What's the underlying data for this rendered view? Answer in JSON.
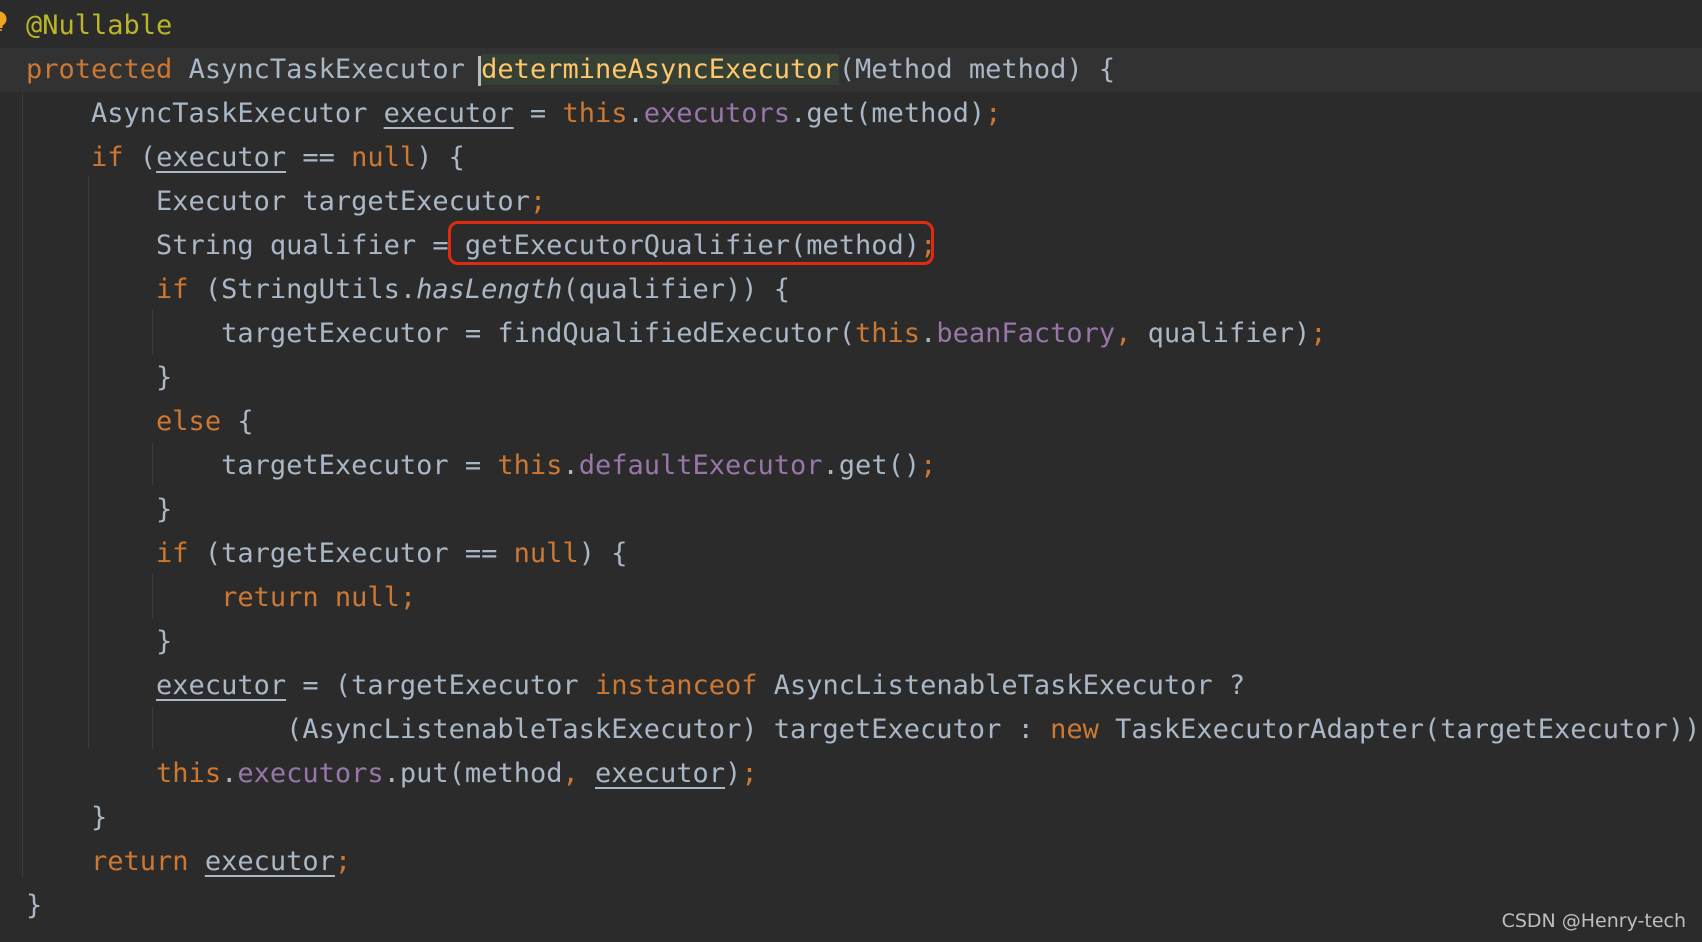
{
  "editor": {
    "lines": [
      {
        "segments": [
          {
            "t": "@Nullable",
            "c": "ann"
          }
        ]
      },
      {
        "current": true,
        "segments": [
          {
            "t": "protected ",
            "c": "kw"
          },
          {
            "t": "AsyncTaskExecutor "
          },
          {
            "caret": true
          },
          {
            "t": "determineAsyncExecutor",
            "c": "fn fn-highlight"
          },
          {
            "t": "(Method method) {"
          }
        ]
      },
      {
        "segments": [
          {
            "t": "    AsyncTaskExecutor "
          },
          {
            "t": "executor",
            "c": "ul"
          },
          {
            "t": " = "
          },
          {
            "t": "this",
            "c": "kw"
          },
          {
            "t": "."
          },
          {
            "t": "executors",
            "c": "fld"
          },
          {
            "t": ".get(method)"
          },
          {
            "t": ";",
            "c": "sep"
          }
        ]
      },
      {
        "segments": [
          {
            "t": "    "
          },
          {
            "t": "if",
            "c": "kw"
          },
          {
            "t": " ("
          },
          {
            "t": "executor",
            "c": "ul"
          },
          {
            "t": " == "
          },
          {
            "t": "null",
            "c": "kw"
          },
          {
            "t": ") {"
          }
        ]
      },
      {
        "segments": [
          {
            "t": "        Executor targetExecutor"
          },
          {
            "t": ";",
            "c": "sep"
          }
        ]
      },
      {
        "segments": [
          {
            "t": "        String qualifier = "
          },
          {
            "t": "getExecutorQualifier(method)"
          },
          {
            "t": ";",
            "c": "sep"
          }
        ]
      },
      {
        "segments": [
          {
            "t": "        "
          },
          {
            "t": "if",
            "c": "kw"
          },
          {
            "t": " (StringUtils."
          },
          {
            "t": "hasLength",
            "c": "it"
          },
          {
            "t": "(qualifier)) {"
          }
        ]
      },
      {
        "segments": [
          {
            "t": "            targetExecutor = findQualifiedExecutor("
          },
          {
            "t": "this",
            "c": "kw"
          },
          {
            "t": "."
          },
          {
            "t": "beanFactory",
            "c": "fld"
          },
          {
            "t": ",",
            "c": "sep"
          },
          {
            "t": " qualifier)"
          },
          {
            "t": ";",
            "c": "sep"
          }
        ]
      },
      {
        "segments": [
          {
            "t": "        }"
          }
        ]
      },
      {
        "segments": [
          {
            "t": "        "
          },
          {
            "t": "else",
            "c": "kw"
          },
          {
            "t": " {"
          }
        ]
      },
      {
        "segments": [
          {
            "t": "            targetExecutor = "
          },
          {
            "t": "this",
            "c": "kw"
          },
          {
            "t": "."
          },
          {
            "t": "defaultExecutor",
            "c": "fld"
          },
          {
            "t": ".get()"
          },
          {
            "t": ";",
            "c": "sep"
          }
        ]
      },
      {
        "segments": [
          {
            "t": "        }"
          }
        ]
      },
      {
        "segments": [
          {
            "t": "        "
          },
          {
            "t": "if",
            "c": "kw"
          },
          {
            "t": " (targetExecutor == "
          },
          {
            "t": "null",
            "c": "kw"
          },
          {
            "t": ") {"
          }
        ]
      },
      {
        "segments": [
          {
            "t": "            "
          },
          {
            "t": "return null;",
            "c": "kw"
          }
        ]
      },
      {
        "segments": [
          {
            "t": "        }"
          }
        ]
      },
      {
        "segments": [
          {
            "t": "        "
          },
          {
            "t": "executor",
            "c": "ul"
          },
          {
            "t": " = (targetExecutor "
          },
          {
            "t": "instanceof",
            "c": "kw"
          },
          {
            "t": " AsyncListenableTaskExecutor ?"
          }
        ]
      },
      {
        "segments": [
          {
            "t": "                (AsyncListenableTaskExecutor) targetExecutor : "
          },
          {
            "t": "new",
            "c": "kw"
          },
          {
            "t": " TaskExecutorAdapter(targetExecutor))"
          },
          {
            "t": ";",
            "c": "sep"
          }
        ]
      },
      {
        "segments": [
          {
            "t": "        "
          },
          {
            "t": "this",
            "c": "kw"
          },
          {
            "t": "."
          },
          {
            "t": "executors",
            "c": "fld"
          },
          {
            "t": ".put(method"
          },
          {
            "t": ",",
            "c": "sep"
          },
          {
            "t": " "
          },
          {
            "t": "executor",
            "c": "ul"
          },
          {
            "t": ")"
          },
          {
            "t": ";",
            "c": "sep"
          }
        ]
      },
      {
        "segments": [
          {
            "t": "    }"
          }
        ]
      },
      {
        "segments": [
          {
            "t": "    "
          },
          {
            "t": "return",
            "c": "kw"
          },
          {
            "t": " "
          },
          {
            "t": "executor",
            "c": "ul"
          },
          {
            "t": ";",
            "c": "sep"
          }
        ]
      },
      {
        "segments": [
          {
            "t": "}"
          }
        ]
      }
    ]
  },
  "icons": {
    "gutter": "lightbulb-icon"
  },
  "colors": {
    "background": "#2b2b2b",
    "keyword": "#cc7832",
    "annotation": "#bbb529",
    "field": "#9876aa",
    "method": "#ffc66d",
    "plain": "#a9b7c6",
    "highlight_box": "#e12b10"
  },
  "watermark": "CSDN @Henry-tech"
}
